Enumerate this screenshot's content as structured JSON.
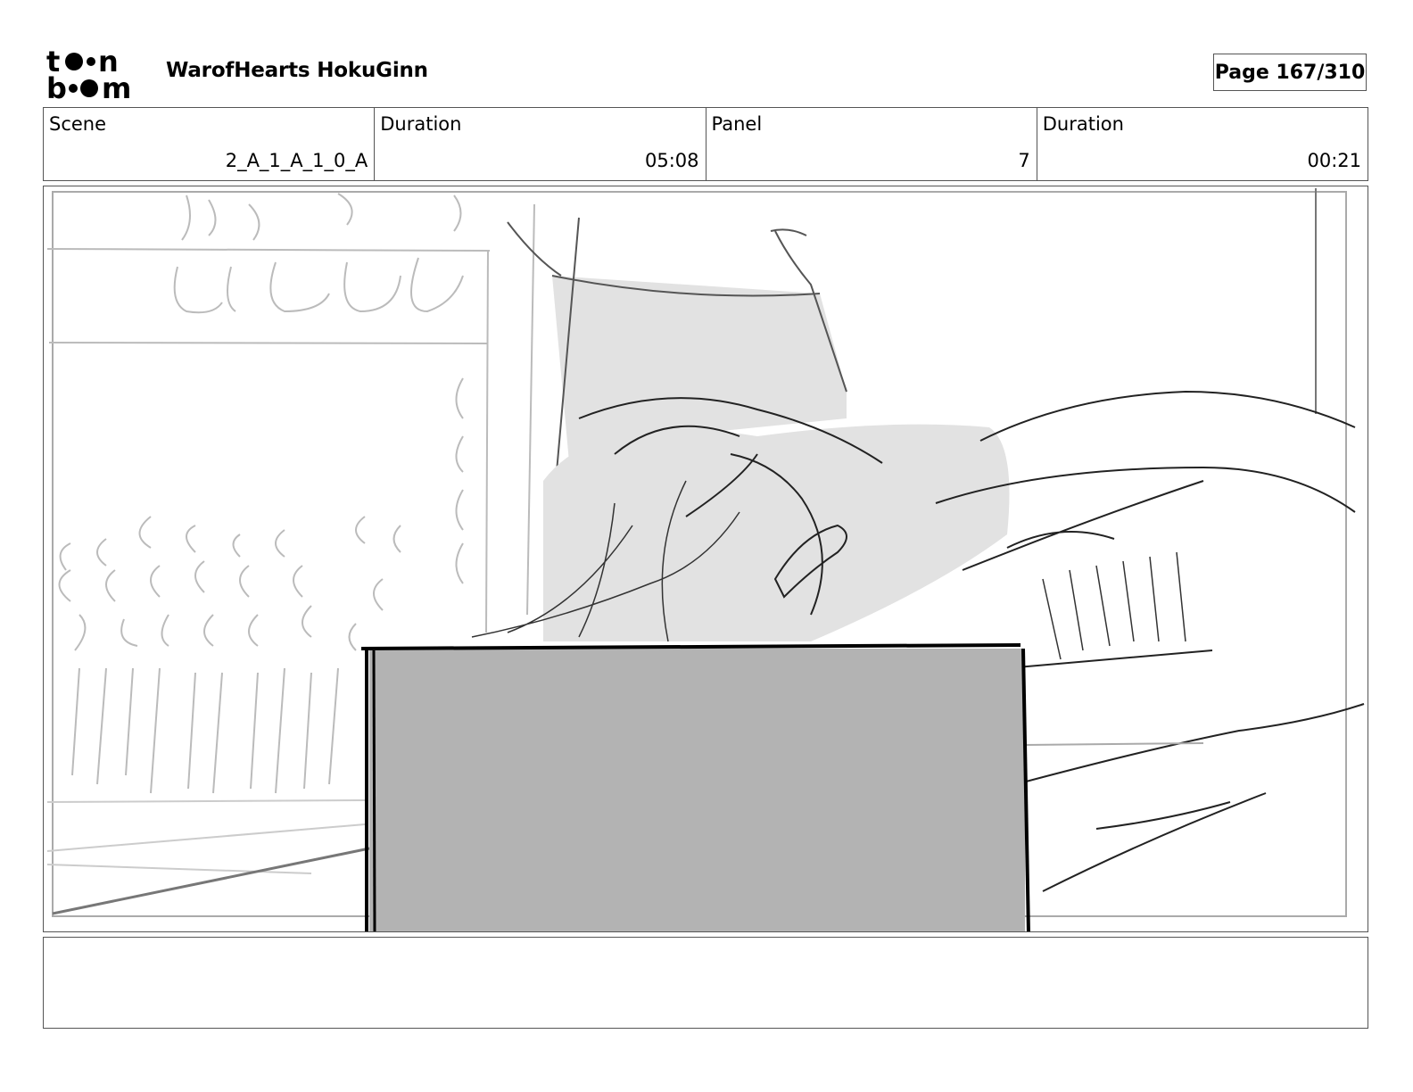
{
  "header": {
    "logo_alt": "toon boom",
    "project_title": "WarofHearts HokuGinn",
    "page_label": "Page 167/310"
  },
  "info": [
    {
      "label": "Scene",
      "value": "2_A_1_A_1_0_A"
    },
    {
      "label": "Duration",
      "value": "05:08"
    },
    {
      "label": "Panel",
      "value": "7"
    },
    {
      "label": "Duration",
      "value": "00:21"
    }
  ],
  "panel": {
    "image_icon": "storyboard-sketch",
    "fill_color": "#b3b3b3",
    "shade_color": "#e2e2e2"
  },
  "notes": {
    "text": ""
  }
}
